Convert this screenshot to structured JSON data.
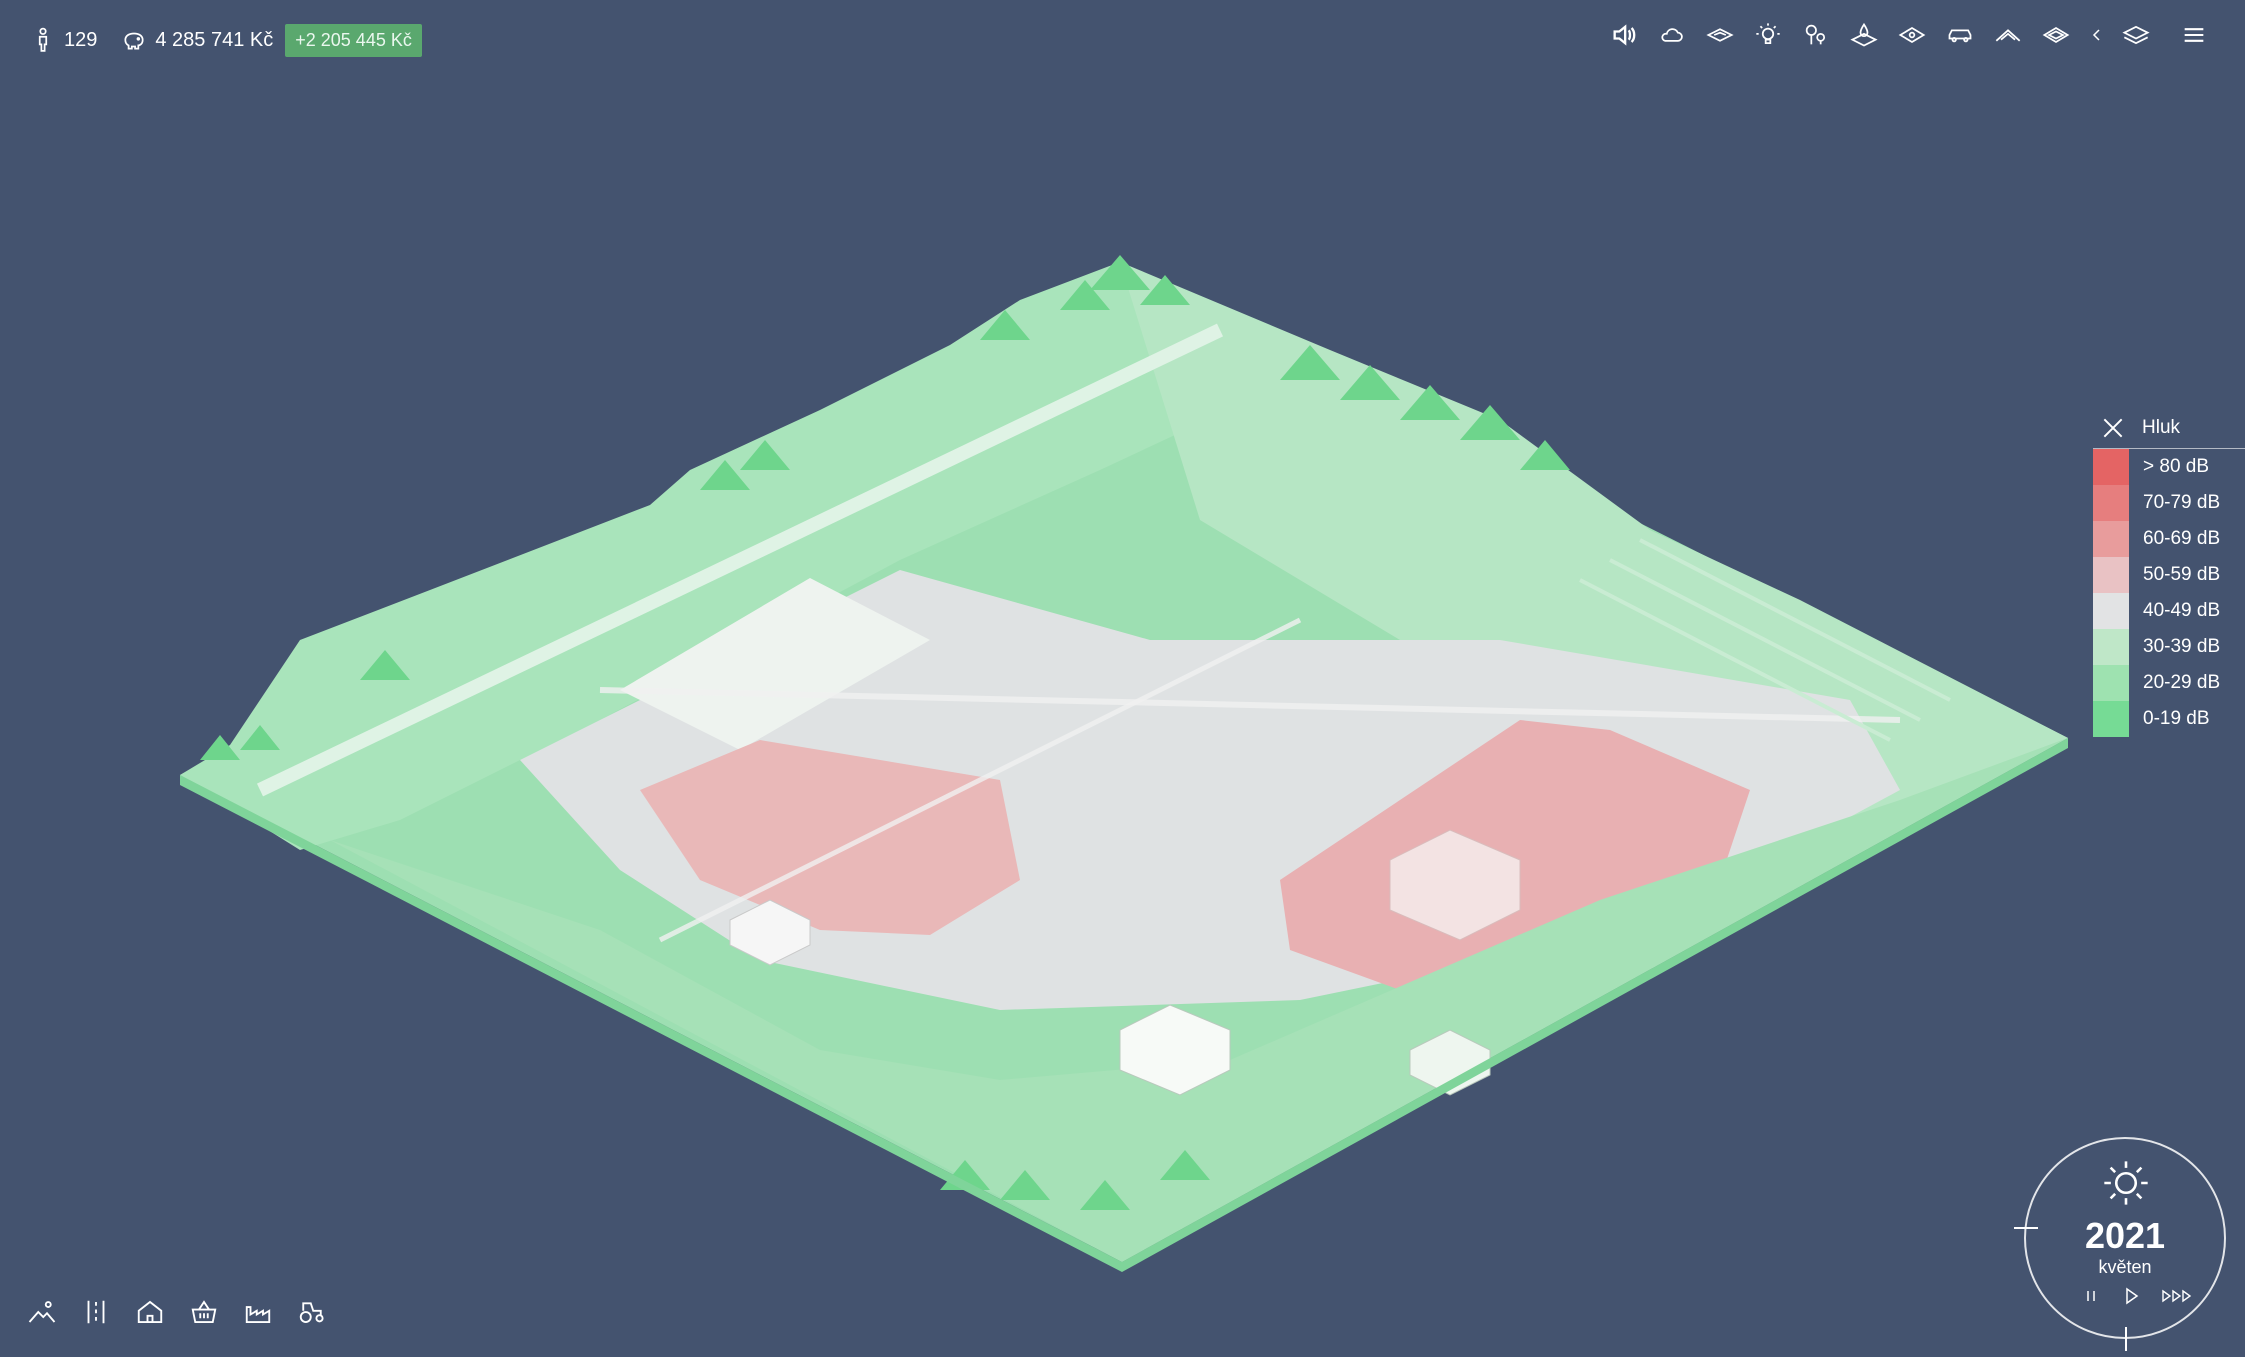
{
  "hud": {
    "population": "129",
    "budget": "4 285 741 Kč",
    "budget_delta": "+2 205 445 Kč"
  },
  "toolbar": {
    "icons": [
      "speaker-icon",
      "cloud-icon",
      "layer-terrain-icon",
      "lightbulb-icon",
      "trees-icon",
      "water-drop-icon",
      "eye-layer-icon",
      "car-icon",
      "road-icon",
      "layer-diamond-icon",
      "chevron-left-icon",
      "layers-stack-icon",
      "menu-icon"
    ]
  },
  "legend": {
    "title": "Hluk",
    "items": [
      {
        "label": "> 80 dB",
        "color": "#e46464"
      },
      {
        "label": "70-79 dB",
        "color": "#e67e7e"
      },
      {
        "label": "60-69 dB",
        "color": "#e89c9c"
      },
      {
        "label": "50-59 dB",
        "color": "#e9c2c4"
      },
      {
        "label": "40-49 dB",
        "color": "#e2e3e4"
      },
      {
        "label": "30-39 dB",
        "color": "#bfe7c8"
      },
      {
        "label": "20-29 dB",
        "color": "#9ee2b0"
      },
      {
        "label": "0-19 dB",
        "color": "#76db95"
      }
    ]
  },
  "bottom_tools": [
    "landscape-icon",
    "roads-icon",
    "house-icon",
    "basket-icon",
    "factory-icon",
    "tractor-icon"
  ],
  "clock": {
    "year": "2021",
    "month": "květen"
  },
  "colors": {
    "background": "#44536f",
    "accent_green": "#5aa86e"
  }
}
